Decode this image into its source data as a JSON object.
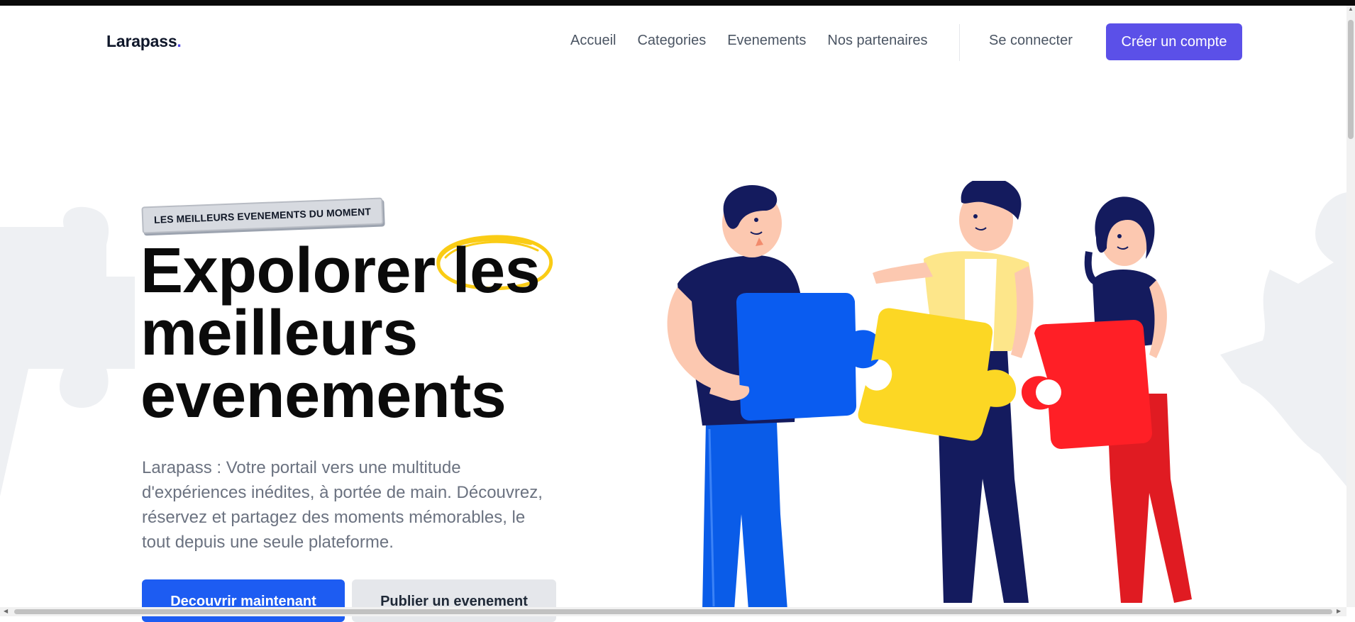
{
  "header": {
    "logo_text": "Larapass",
    "logo_dot": ".",
    "nav": [
      {
        "label": "Accueil"
      },
      {
        "label": "Categories"
      },
      {
        "label": "Evenements"
      },
      {
        "label": "Nos partenaires"
      }
    ],
    "login_label": "Se connecter",
    "signup_label": "Créer un compte"
  },
  "hero": {
    "badge": "LES MEILLEURS EVENEMENTS DU MOMENT",
    "title_word_1": "Expolorer",
    "title_word_highlight": "les",
    "title_line_2": "meilleurs",
    "title_line_3": "evenements",
    "description": "Larapass : Votre portail vers une multitude d'expériences inédites, à portée de main. Découvrez, réservez et partagez des moments mémorables, le tout depuis une seule plateforme.",
    "primary_button": "Decouvrir maintenant",
    "secondary_button": "Publier un evenement"
  },
  "colors": {
    "brand": "#5b50e8",
    "primary_button": "#1d5cf2",
    "highlight_circle": "#facc15",
    "puzzle_blue": "#0a5cf0",
    "puzzle_yellow": "#fcd724",
    "puzzle_red": "#ff1f26"
  },
  "icons": {
    "illustration": "people-holding-puzzle-pieces",
    "scroll_up": "triangle-up",
    "scroll_left": "triangle-left",
    "scroll_right": "triangle-right"
  }
}
